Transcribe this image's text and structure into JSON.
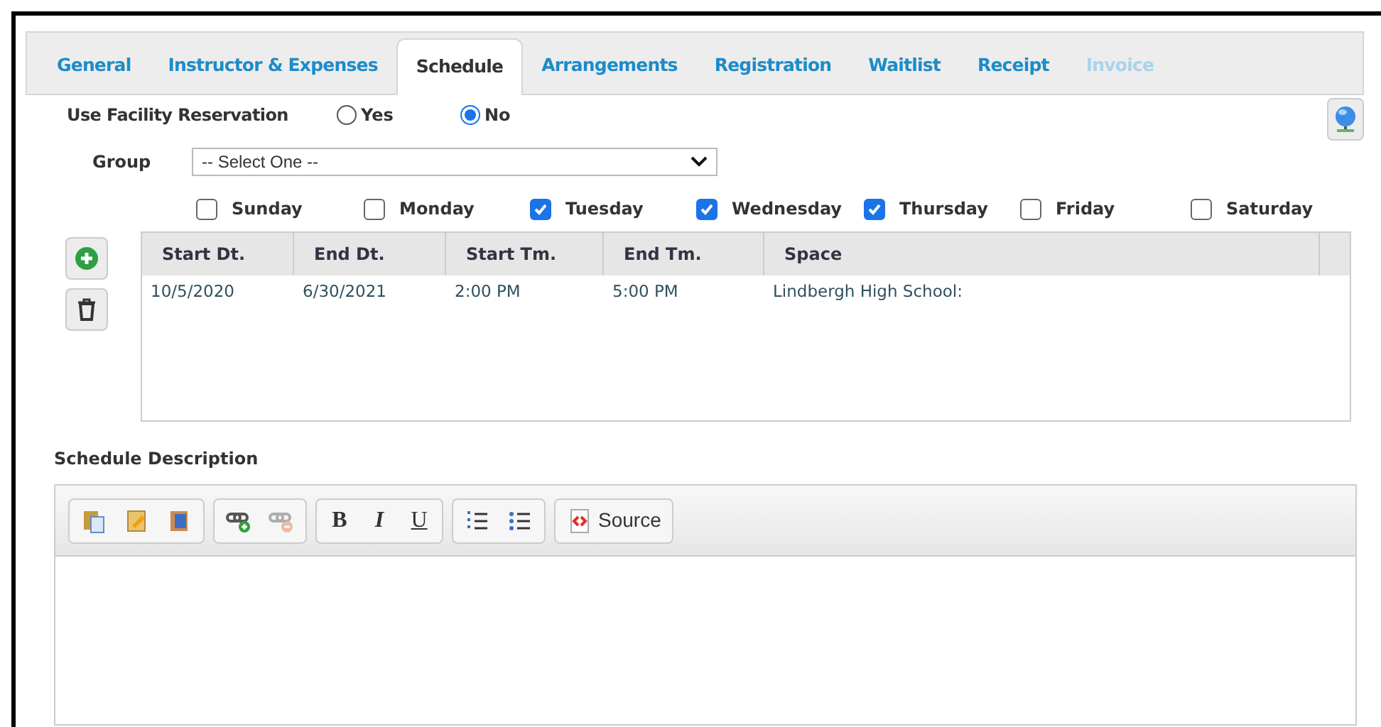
{
  "tabs": [
    {
      "label": "General",
      "selected": false,
      "disabled": false
    },
    {
      "label": "Instructor & Expenses",
      "selected": false,
      "disabled": false
    },
    {
      "label": "Schedule",
      "selected": true,
      "disabled": false
    },
    {
      "label": "Arrangements",
      "selected": false,
      "disabled": false
    },
    {
      "label": "Registration",
      "selected": false,
      "disabled": false
    },
    {
      "label": "Waitlist",
      "selected": false,
      "disabled": false
    },
    {
      "label": "Receipt",
      "selected": false,
      "disabled": false
    },
    {
      "label": "Invoice",
      "selected": false,
      "disabled": true
    }
  ],
  "facility_reservation": {
    "label": "Use Facility Reservation",
    "options": [
      {
        "label": "Yes",
        "selected": false
      },
      {
        "label": "No",
        "selected": true
      }
    ]
  },
  "group": {
    "label": "Group",
    "value": "-- Select One --"
  },
  "days": [
    {
      "label": "Sunday",
      "checked": false
    },
    {
      "label": "Monday",
      "checked": false
    },
    {
      "label": "Tuesday",
      "checked": true
    },
    {
      "label": "Wednesday",
      "checked": true
    },
    {
      "label": "Thursday",
      "checked": true
    },
    {
      "label": "Friday",
      "checked": false
    },
    {
      "label": "Saturday",
      "checked": false
    }
  ],
  "table": {
    "columns": [
      "Start Dt.",
      "End Dt.",
      "Start Tm.",
      "End Tm.",
      "Space"
    ],
    "rows": [
      [
        "10/5/2020",
        "6/30/2021",
        "2:00 PM",
        "5:00 PM",
        "Lindbergh High School:"
      ]
    ]
  },
  "description": {
    "label": "Schedule Description",
    "toolbar": [
      [
        {
          "kind": "paste",
          "disabled": false
        },
        {
          "kind": "paste-text",
          "disabled": false
        },
        {
          "kind": "paste-word",
          "disabled": false
        }
      ],
      [
        {
          "kind": "link",
          "disabled": false
        },
        {
          "kind": "unlink",
          "disabled": true
        }
      ],
      [
        {
          "kind": "bold",
          "label": "B",
          "disabled": false
        },
        {
          "kind": "italic",
          "label": "I",
          "disabled": false
        },
        {
          "kind": "underline",
          "label": "U",
          "disabled": false
        }
      ],
      [
        {
          "kind": "numbered-list",
          "disabled": false
        },
        {
          "kind": "bulleted-list",
          "disabled": false
        }
      ],
      [
        {
          "kind": "source",
          "label": "Source",
          "disabled": false
        }
      ]
    ]
  }
}
